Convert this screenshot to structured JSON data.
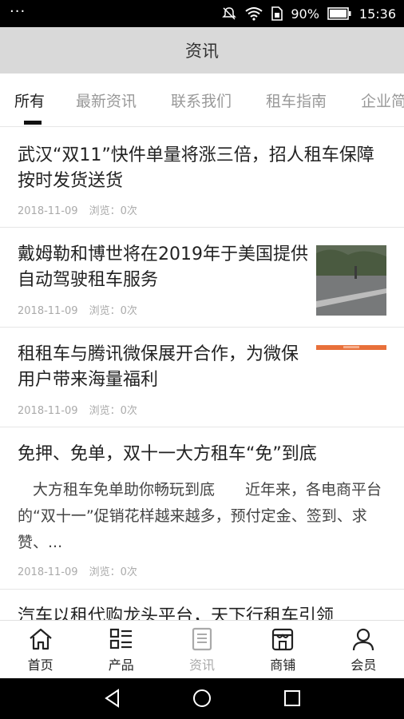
{
  "status_bar": {
    "dots": "···",
    "battery": "90%",
    "time": "15:36"
  },
  "header": {
    "title": "资讯"
  },
  "tabs": [
    {
      "label": "所有"
    },
    {
      "label": "最新资讯"
    },
    {
      "label": "联系我们"
    },
    {
      "label": "租车指南"
    },
    {
      "label": "企业简介"
    }
  ],
  "articles": [
    {
      "title": "武汉“双11”快件单量将涨三倍，招人租车保障按时发货送货",
      "date": "2018-11-09",
      "views": "浏览：0次"
    },
    {
      "title": "戴姆勒和博世将在2019年于美国提供自动驾驶租车服务",
      "date": "2018-11-09",
      "views": "浏览：0次",
      "thumb_icon": "road-photo"
    },
    {
      "title": "租租车与腾讯微保展开合作，为微保用户带来海量福利",
      "date": "2018-11-09",
      "views": "浏览：0次",
      "thumb_icon": "orange-banner"
    },
    {
      "title": "免押、免单，双十一大方租车“免”到底",
      "summary": "　大方租车免单助你畅玩到底　　近年来，各电商平台的“双十一”促销花样越来越多，预付定金、签到、求赞、...",
      "date": "2018-11-09",
      "views": "浏览：0次"
    },
    {
      "title": "汽车以租代购龙头平台，天下行租车引领"
    }
  ],
  "bottom_nav": [
    {
      "label": "首页",
      "icon": "home-icon"
    },
    {
      "label": "产品",
      "icon": "list-icon"
    },
    {
      "label": "资讯",
      "icon": "news-icon"
    },
    {
      "label": "商铺",
      "icon": "store-icon"
    },
    {
      "label": "会员",
      "icon": "user-icon"
    }
  ],
  "colors": {
    "header_bg": "#d9d9d9",
    "active_tab": "#222222",
    "inactive_tab": "#999999",
    "accent_orange": "#e8703a"
  }
}
